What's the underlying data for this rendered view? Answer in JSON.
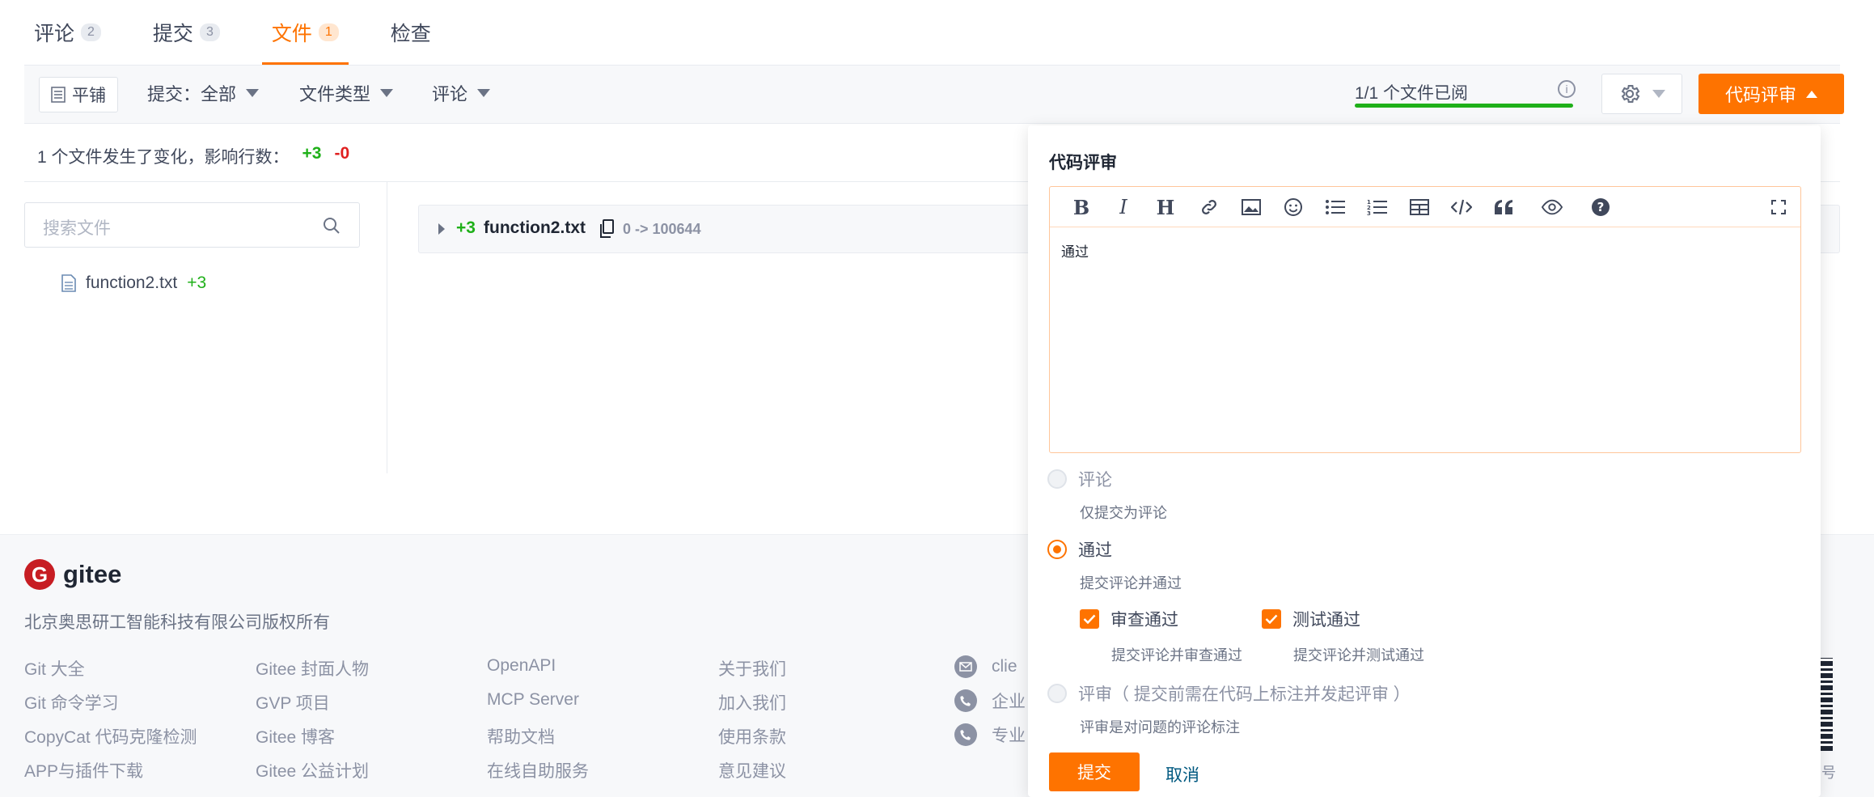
{
  "tabs": [
    {
      "label": "评论",
      "count": "2"
    },
    {
      "label": "提交",
      "count": "3"
    },
    {
      "label": "文件",
      "count": "1"
    },
    {
      "label": "检查",
      "count": ""
    }
  ],
  "toolbar": {
    "flat_label": "平铺",
    "commit_filter": "提交：全部",
    "file_type_filter": "文件类型",
    "comment_filter": "评论",
    "progress_text": "1/1 个文件已阅",
    "progress_fraction": 1.0,
    "review_button": "代码评审"
  },
  "summary": {
    "text": "1 个文件发生了变化，影响行数：",
    "additions": "+3",
    "deletions": "-0"
  },
  "file_panel": {
    "search_placeholder": "搜索文件",
    "files": [
      {
        "name": "function2.txt",
        "additions": "+3"
      }
    ]
  },
  "diff": {
    "additions": "+3",
    "file_name": "function2.txt",
    "mode": "0 -> 100644"
  },
  "footer": {
    "brand": "gitee",
    "copyright": "北京奥思研工智能科技有限公司版权所有",
    "col1": [
      "Git 大全",
      "Git 命令学习",
      "CopyCat 代码克隆检测",
      "APP与插件下载"
    ],
    "col2": [
      "Gitee 封面人物",
      "GVP 项目",
      "Gitee 博客",
      "Gitee 公益计划"
    ],
    "col3": [
      "OpenAPI",
      "MCP Server",
      "帮助文档",
      "在线自助服务"
    ],
    "col4": [
      "关于我们",
      "加入我们",
      "使用条款",
      "意见建议"
    ],
    "contacts": [
      "clie",
      "企业",
      "专业"
    ],
    "qr_label": "号"
  },
  "review_popup": {
    "title": "代码评审",
    "editor_text": "通过",
    "options": [
      {
        "label": "评论",
        "desc": "仅提交为评论"
      },
      {
        "label": "通过",
        "desc": "提交评论并通过"
      },
      {
        "label": "评审（ 提交前需在代码上标注并发起评审 ）",
        "desc": "评审是对问题的评论标注"
      }
    ],
    "checks": [
      {
        "label": "审查通过",
        "desc": "提交评论并审查通过"
      },
      {
        "label": "测试通过",
        "desc": "提交评论并测试通过"
      }
    ],
    "submit": "提交",
    "cancel": "取消"
  },
  "colors": {
    "accent": "#fe7300",
    "add": "#1fb019",
    "del": "#e02020",
    "link": "#005980"
  }
}
